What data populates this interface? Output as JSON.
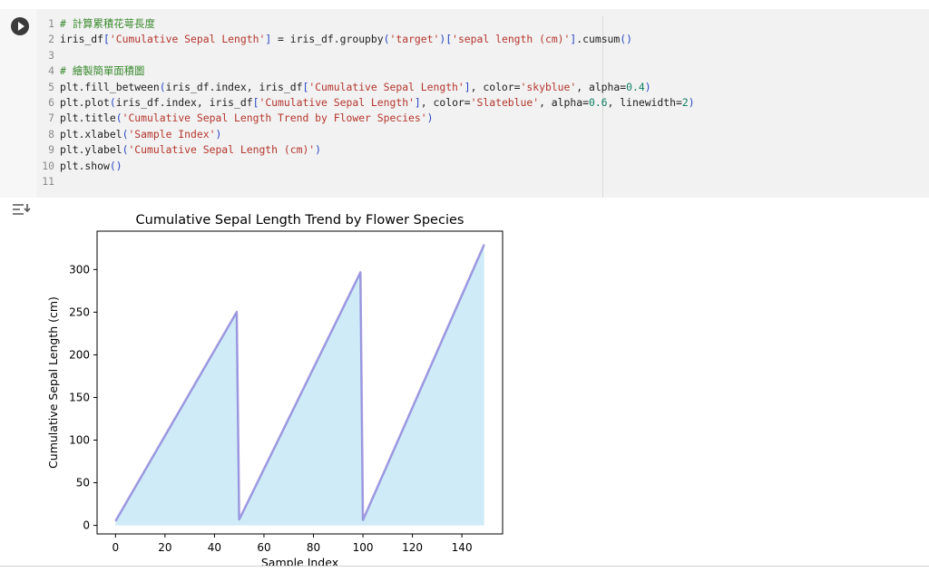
{
  "cell": {
    "run_button": "run-cell",
    "lines": [
      {
        "num": "1",
        "tokens": [
          {
            "t": "# 計算累積花萼長度",
            "c": "cm"
          }
        ]
      },
      {
        "num": "2",
        "tokens": [
          {
            "t": "iris_df"
          },
          {
            "t": "[",
            "c": "p"
          },
          {
            "t": "'Cumulative Sepal Length'",
            "c": "s"
          },
          {
            "t": "]",
            "c": "p"
          },
          {
            "t": " = iris_df.groupby"
          },
          {
            "t": "(",
            "c": "p"
          },
          {
            "t": "'target'",
            "c": "s"
          },
          {
            "t": ")[",
            "c": "p"
          },
          {
            "t": "'sepal length (cm)'",
            "c": "s"
          },
          {
            "t": "]",
            "c": "p"
          },
          {
            "t": ".cumsum"
          },
          {
            "t": "()",
            "c": "p"
          }
        ]
      },
      {
        "num": "3",
        "tokens": []
      },
      {
        "num": "4",
        "tokens": [
          {
            "t": "# 繪製簡單面積圖",
            "c": "cm"
          }
        ]
      },
      {
        "num": "5",
        "tokens": [
          {
            "t": "plt.fill_between"
          },
          {
            "t": "(",
            "c": "p"
          },
          {
            "t": "iris_df.index, iris_df"
          },
          {
            "t": "[",
            "c": "p"
          },
          {
            "t": "'Cumulative Sepal Length'",
            "c": "s"
          },
          {
            "t": "]",
            "c": "p"
          },
          {
            "t": ", color="
          },
          {
            "t": "'skyblue'",
            "c": "s"
          },
          {
            "t": ", alpha="
          },
          {
            "t": "0.4",
            "c": "n"
          },
          {
            "t": ")",
            "c": "p"
          }
        ]
      },
      {
        "num": "6",
        "tokens": [
          {
            "t": "plt.plot"
          },
          {
            "t": "(",
            "c": "p"
          },
          {
            "t": "iris_df.index, iris_df"
          },
          {
            "t": "[",
            "c": "p"
          },
          {
            "t": "'Cumulative Sepal Length'",
            "c": "s"
          },
          {
            "t": "]",
            "c": "p"
          },
          {
            "t": ", color="
          },
          {
            "t": "'Slateblue'",
            "c": "s"
          },
          {
            "t": ", alpha="
          },
          {
            "t": "0.6",
            "c": "n"
          },
          {
            "t": ", linewidth="
          },
          {
            "t": "2",
            "c": "n"
          },
          {
            "t": ")",
            "c": "p"
          }
        ]
      },
      {
        "num": "7",
        "tokens": [
          {
            "t": "plt.title"
          },
          {
            "t": "(",
            "c": "p"
          },
          {
            "t": "'Cumulative Sepal Length Trend by Flower Species'",
            "c": "s"
          },
          {
            "t": ")",
            "c": "p"
          }
        ]
      },
      {
        "num": "8",
        "tokens": [
          {
            "t": "plt.xlabel"
          },
          {
            "t": "(",
            "c": "p"
          },
          {
            "t": "'Sample Index'",
            "c": "s"
          },
          {
            "t": ")",
            "c": "p"
          }
        ]
      },
      {
        "num": "9",
        "tokens": [
          {
            "t": "plt.ylabel"
          },
          {
            "t": "(",
            "c": "p"
          },
          {
            "t": "'Cumulative Sepal Length (cm)'",
            "c": "s"
          },
          {
            "t": ")",
            "c": "p"
          }
        ]
      },
      {
        "num": "10",
        "tokens": [
          {
            "t": "plt.show"
          },
          {
            "t": "()",
            "c": "p"
          }
        ]
      },
      {
        "num": "11",
        "tokens": []
      }
    ]
  },
  "output": {
    "icon": "output-settings-icon"
  },
  "colors": {
    "fill": "#87ceeb",
    "line": "#6a5acd",
    "comment": "#3b8a2f",
    "string": "#b5362d",
    "number": "#0e7f62",
    "paren": "#2a46c4"
  },
  "chart_data": {
    "type": "area",
    "title": "Cumulative Sepal Length Trend by Flower Species",
    "xlabel": "Sample Index",
    "ylabel": "Cumulative Sepal Length (cm)",
    "xlim": [
      -7.45,
      156.45
    ],
    "ylim": [
      -10,
      345
    ],
    "xticks": [
      0,
      20,
      40,
      60,
      80,
      100,
      120,
      140
    ],
    "yticks": [
      0,
      50,
      100,
      150,
      200,
      250,
      300
    ],
    "grid": false,
    "series": [
      {
        "x_start": 0,
        "x_end": 49,
        "y_start": 5.1,
        "y_end": 250.3
      },
      {
        "x_start": 50,
        "x_end": 99,
        "y_start": 7.0,
        "y_end": 296.8
      },
      {
        "x_start": 100,
        "x_end": 149,
        "y_start": 6.3,
        "y_end": 329.4
      }
    ]
  }
}
